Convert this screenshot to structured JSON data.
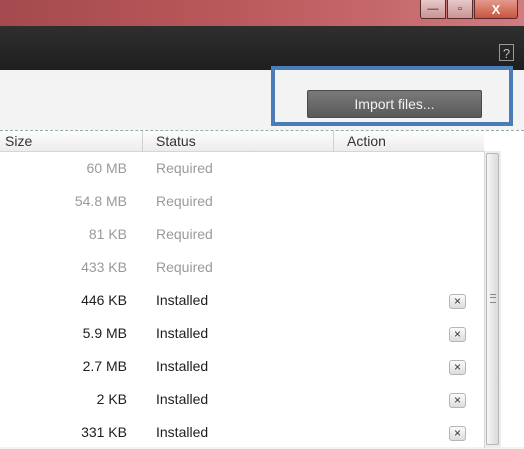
{
  "window": {
    "minimize_label": "—",
    "maximize_label": "▫",
    "close_label": "X"
  },
  "header": {
    "help_label": "?"
  },
  "toolbar": {
    "import_label": "Import files..."
  },
  "table": {
    "columns": {
      "size": "Size",
      "status": "Status",
      "action": "Action"
    },
    "rows": [
      {
        "size": "60 MB",
        "status": "Required",
        "removable": false
      },
      {
        "size": "54.8 MB",
        "status": "Required",
        "removable": false
      },
      {
        "size": "81 KB",
        "status": "Required",
        "removable": false
      },
      {
        "size": "433 KB",
        "status": "Required",
        "removable": false
      },
      {
        "size": "446 KB",
        "status": "Installed",
        "removable": true
      },
      {
        "size": "5.9 MB",
        "status": "Installed",
        "removable": true
      },
      {
        "size": "2.7 MB",
        "status": "Installed",
        "removable": true
      },
      {
        "size": "2 KB",
        "status": "Installed",
        "removable": true
      },
      {
        "size": "331 KB",
        "status": "Installed",
        "removable": true
      }
    ],
    "remove_glyph": "×"
  }
}
